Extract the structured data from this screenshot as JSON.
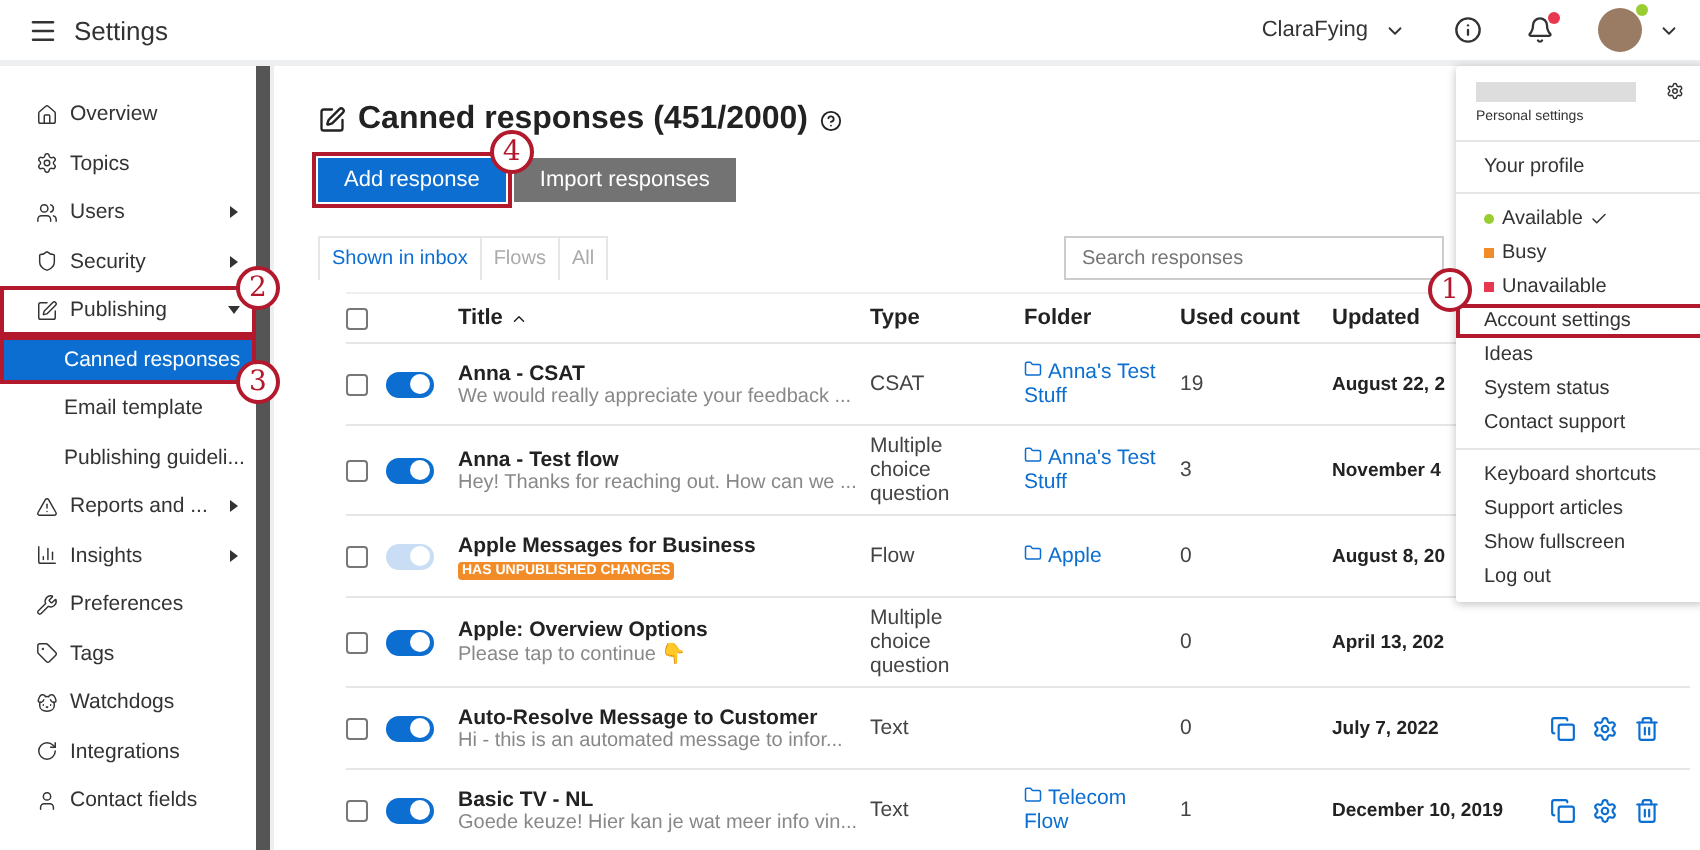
{
  "topbar": {
    "title": "Settings",
    "account": "ClaraFying",
    "notifications_unread": true,
    "avatar_online": true
  },
  "sidebar": {
    "items": [
      {
        "label": "Overview"
      },
      {
        "label": "Topics"
      },
      {
        "label": "Users",
        "expanded": false
      },
      {
        "label": "Security",
        "expanded": false
      },
      {
        "label": "Publishing",
        "expanded": true,
        "callout": "2",
        "children": [
          {
            "label": "Canned responses",
            "selected": true,
            "callout": "3"
          },
          {
            "label": "Email template",
            "selected": false
          },
          {
            "label": "Publishing guideli...",
            "selected": false
          }
        ]
      },
      {
        "label": "Reports and ...",
        "expanded": false
      },
      {
        "label": "Insights",
        "expanded": false
      },
      {
        "label": "Preferences"
      },
      {
        "label": "Tags"
      },
      {
        "label": "Watchdogs"
      },
      {
        "label": "Integrations"
      },
      {
        "label": "Contact fields"
      }
    ]
  },
  "page": {
    "title": "Canned responses (451/2000)",
    "buttons": [
      {
        "label": "Add response",
        "kind": "primary",
        "callout": "4"
      },
      {
        "label": "Import responses",
        "kind": "secondary"
      }
    ],
    "tabs": [
      {
        "label": "Shown in inbox",
        "selected": true
      },
      {
        "label": "Flows",
        "selected": false
      },
      {
        "label": "All",
        "selected": false
      }
    ],
    "search": {
      "placeholder": "Search responses"
    }
  },
  "table": {
    "header_checked": false,
    "columns": [
      {
        "label": "Title",
        "sorted": true
      },
      {
        "label": "Type",
        "sorted": false
      },
      {
        "label": "Folder",
        "sorted": false
      },
      {
        "label": "Used count",
        "sorted": false
      },
      {
        "label": "Updated",
        "sorted": false
      }
    ],
    "rows": [
      {
        "checked": false,
        "on": true,
        "disabled": false,
        "title": "Anna - CSAT",
        "subtitle": "We would really appreciate your feedback ...",
        "type": "CSAT",
        "folder": "Anna's Test Stuff",
        "used": "19",
        "updated": "August 22, 2",
        "show_actions": false
      },
      {
        "checked": false,
        "on": true,
        "disabled": false,
        "title": "Anna - Test flow",
        "subtitle": "Hey! Thanks for reaching out. How can we ...",
        "type": "Multiple choice question",
        "folder": "Anna's Test Stuff",
        "used": "3",
        "updated": "November 4",
        "show_actions": false
      },
      {
        "checked": false,
        "on": true,
        "disabled": true,
        "title": "Apple Messages for Business",
        "badge": "HAS UNPUBLISHED CHANGES",
        "type": "Flow",
        "folder": "Apple",
        "used": "0",
        "updated": "August 8, 20",
        "show_actions": false
      },
      {
        "checked": false,
        "on": true,
        "disabled": false,
        "title": "Apple: Overview Options",
        "subtitle": "Please tap to continue 👇",
        "type": "Multiple choice question",
        "used": "0",
        "updated": "April 13, 202",
        "show_actions": false
      },
      {
        "checked": false,
        "on": true,
        "disabled": false,
        "title": "Auto-Resolve Message to Customer",
        "subtitle": "Hi - this is an automated message to infor...",
        "type": "Text",
        "used": "0",
        "updated": "July 7, 2022",
        "show_actions": true
      },
      {
        "checked": false,
        "on": true,
        "disabled": false,
        "title": "Basic TV - NL",
        "subtitle": "Goede keuze! Hier kan je wat meer info vin...",
        "type": "Text",
        "folder": "Telecom Flow",
        "used": "1",
        "updated": "December 10, 2019",
        "show_actions": true
      }
    ]
  },
  "account_menu": {
    "header": "Personal settings",
    "sections": [
      [
        {
          "kind": "link",
          "label": "Your profile"
        }
      ],
      [
        {
          "kind": "status",
          "label": "Available",
          "color": "#9acd32",
          "selected": true
        },
        {
          "kind": "status",
          "label": "Busy",
          "color": "#f28c28",
          "selected": false
        },
        {
          "kind": "status",
          "label": "Unavailable",
          "color": "#e8384f",
          "selected": false
        },
        {
          "kind": "link",
          "label": "Account settings",
          "callout": "1"
        },
        {
          "kind": "link",
          "label": "Ideas"
        },
        {
          "kind": "link",
          "label": "System status"
        },
        {
          "kind": "link",
          "label": "Contact support"
        }
      ],
      [
        {
          "kind": "link",
          "label": "Keyboard shortcuts"
        },
        {
          "kind": "link",
          "label": "Support articles"
        },
        {
          "kind": "link",
          "label": "Show fullscreen"
        },
        {
          "kind": "link",
          "label": "Log out"
        }
      ]
    ]
  }
}
